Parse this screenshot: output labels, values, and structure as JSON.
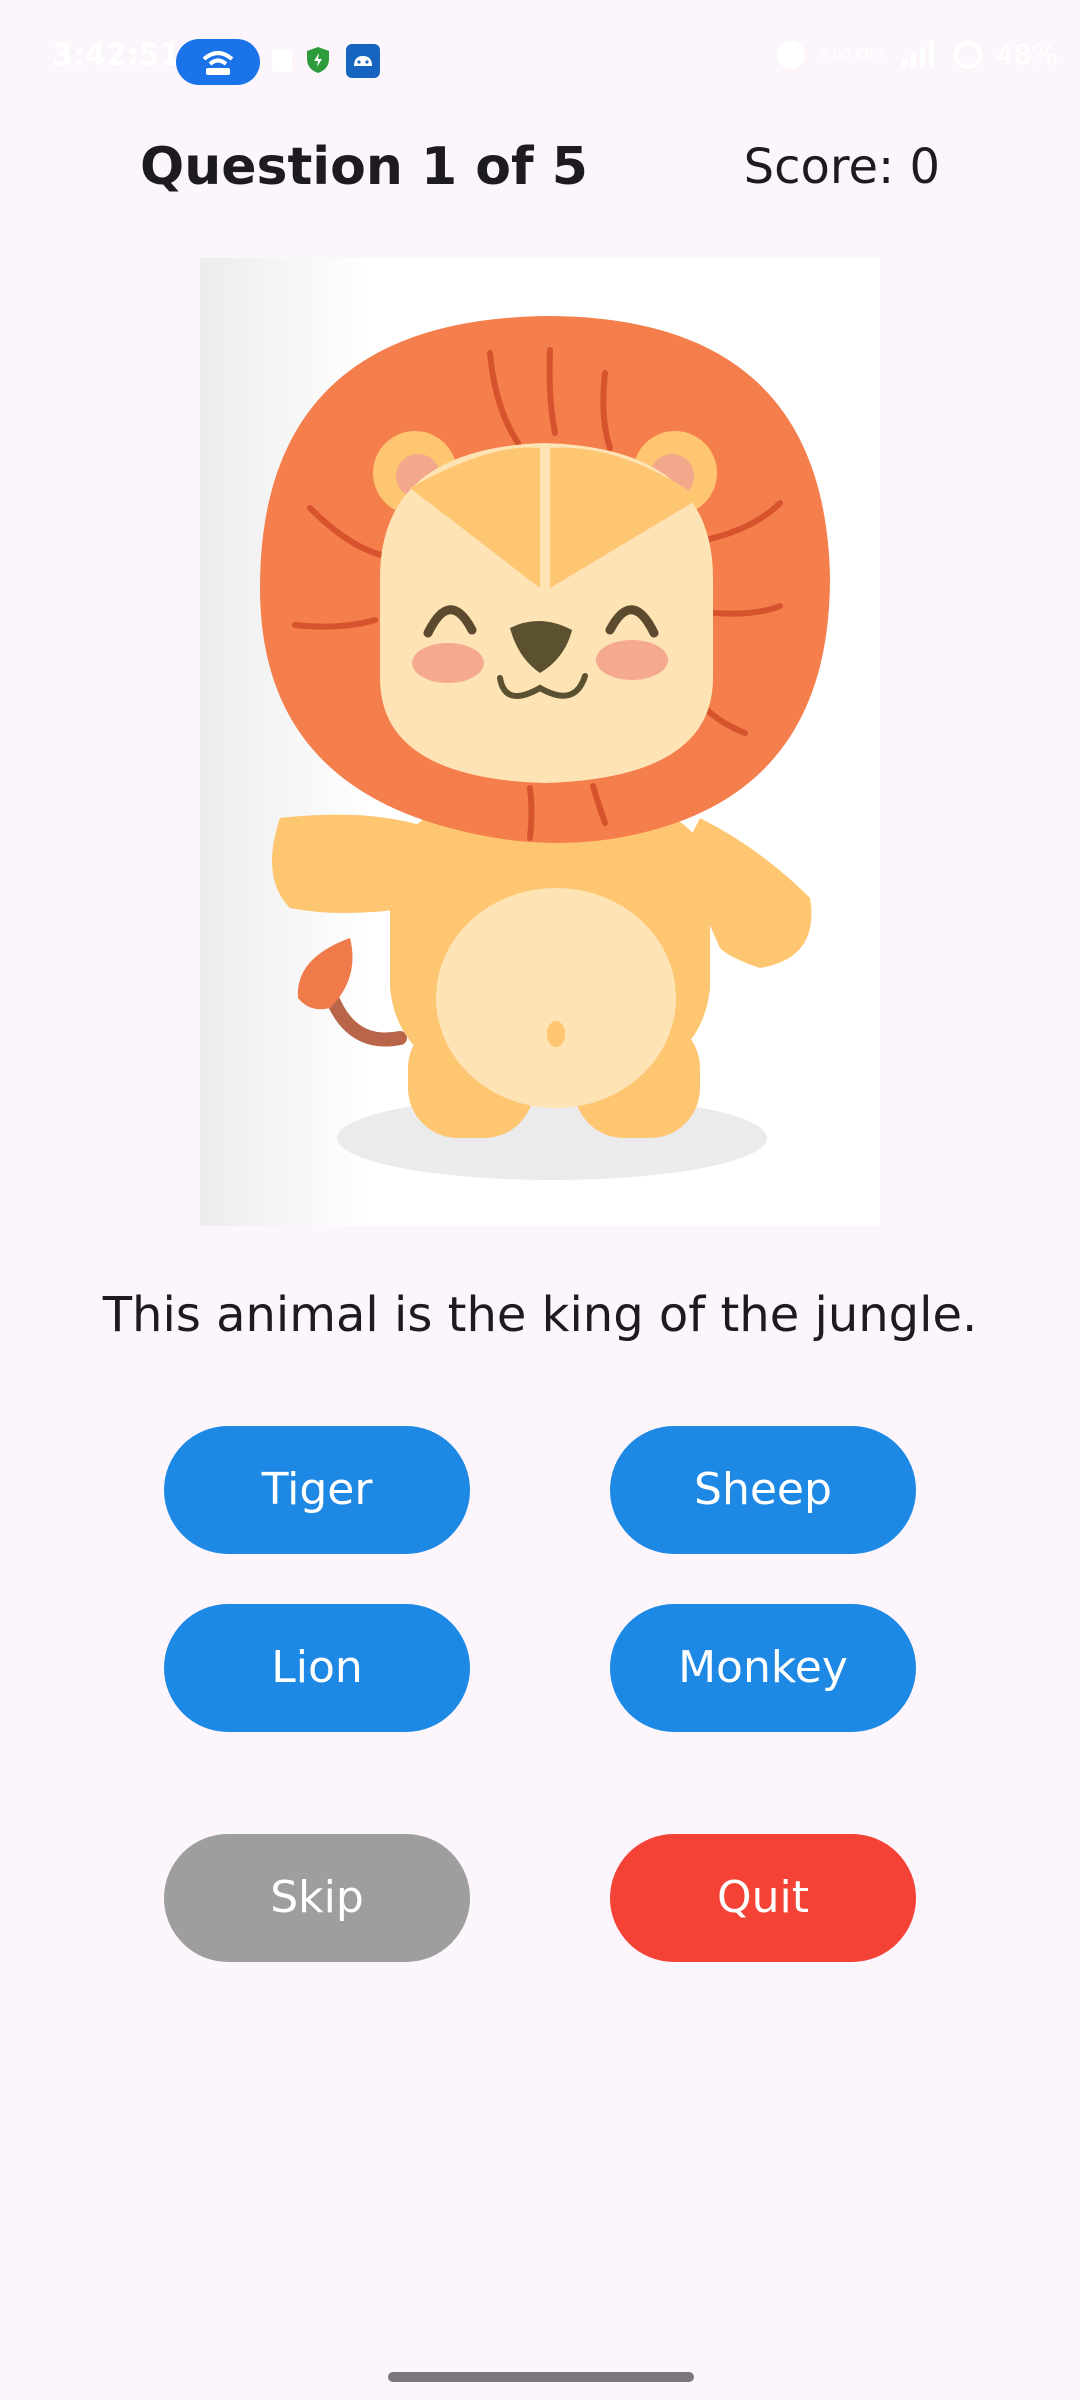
{
  "status_bar": {
    "time": "3:42:51",
    "network": "0.00 KB/s",
    "battery": "48%"
  },
  "header": {
    "question_label": "Question 1 of 5",
    "score_label": "Score: 0"
  },
  "image": {
    "icon": "lion-illustration"
  },
  "question_text": "This animal is the king of the jungle.",
  "answers": [
    "Tiger",
    "Sheep",
    "Lion",
    "Monkey"
  ],
  "actions": {
    "skip": "Skip",
    "quit": "Quit"
  },
  "colors": {
    "answer_button": "#1e88e5",
    "skip_button": "#9e9e9e",
    "quit_button": "#f44336",
    "background": "#fcf5fb"
  }
}
